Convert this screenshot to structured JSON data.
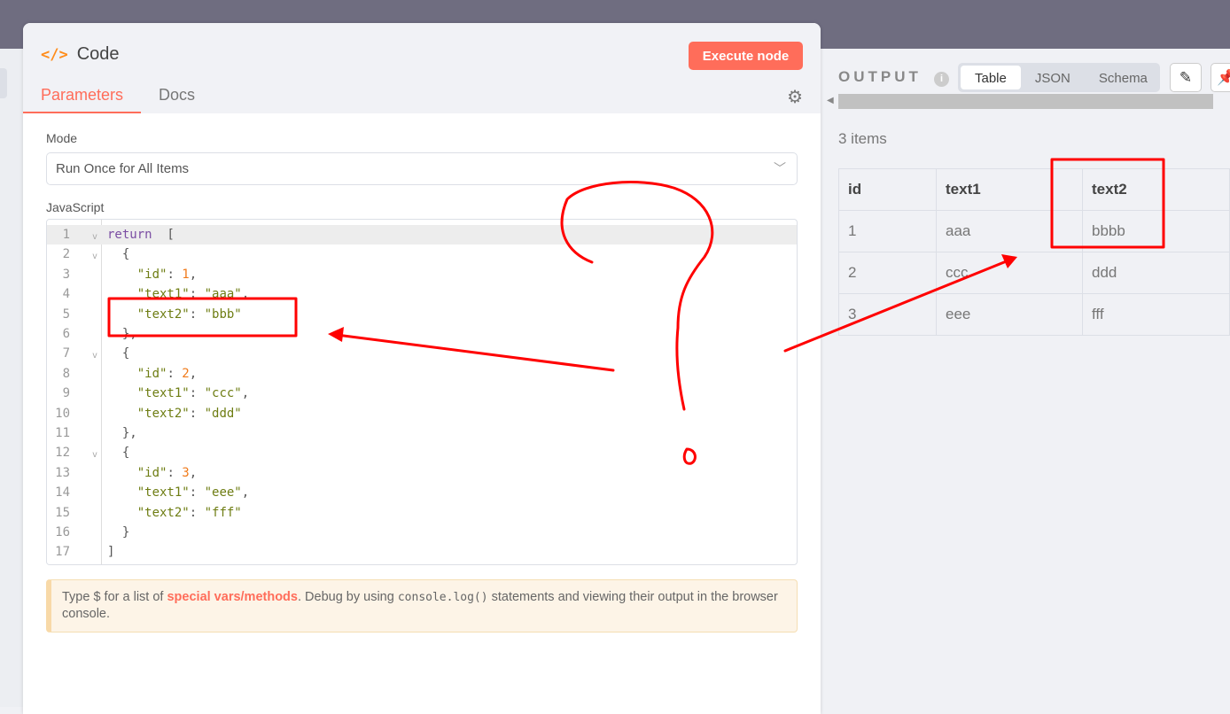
{
  "node": {
    "title": "Code",
    "icon": "code-icon",
    "execute_label": "Execute node",
    "tabs": [
      "Parameters",
      "Docs"
    ],
    "active_tab": "Parameters"
  },
  "params": {
    "mode_label": "Mode",
    "mode_value": "Run Once for All Items",
    "js_label": "JavaScript"
  },
  "code_lines": [
    [
      [
        "kw",
        "return"
      ],
      [
        "",
        "  ["
      ]
    ],
    [
      [
        "",
        "  {"
      ]
    ],
    [
      [
        "",
        "    "
      ],
      [
        "str",
        "\"id\""
      ],
      [
        "",
        ": "
      ],
      [
        "num",
        "1"
      ],
      [
        "",
        ","
      ]
    ],
    [
      [
        "",
        "    "
      ],
      [
        "str",
        "\"text1\""
      ],
      [
        "",
        ": "
      ],
      [
        "str",
        "\"aaa\""
      ],
      [
        "",
        ","
      ]
    ],
    [
      [
        "",
        "    "
      ],
      [
        "str",
        "\"text2\""
      ],
      [
        "",
        ": "
      ],
      [
        "str",
        "\"bbb\""
      ]
    ],
    [
      [
        "",
        "  },"
      ]
    ],
    [
      [
        "",
        "  {"
      ]
    ],
    [
      [
        "",
        "    "
      ],
      [
        "str",
        "\"id\""
      ],
      [
        "",
        ": "
      ],
      [
        "num",
        "2"
      ],
      [
        "",
        ","
      ]
    ],
    [
      [
        "",
        "    "
      ],
      [
        "str",
        "\"text1\""
      ],
      [
        "",
        ": "
      ],
      [
        "str",
        "\"ccc\""
      ],
      [
        "",
        ","
      ]
    ],
    [
      [
        "",
        "    "
      ],
      [
        "str",
        "\"text2\""
      ],
      [
        "",
        ": "
      ],
      [
        "str",
        "\"ddd\""
      ]
    ],
    [
      [
        "",
        "  },"
      ]
    ],
    [
      [
        "",
        "  {"
      ]
    ],
    [
      [
        "",
        "    "
      ],
      [
        "str",
        "\"id\""
      ],
      [
        "",
        ": "
      ],
      [
        "num",
        "3"
      ],
      [
        "",
        ","
      ]
    ],
    [
      [
        "",
        "    "
      ],
      [
        "str",
        "\"text1\""
      ],
      [
        "",
        ": "
      ],
      [
        "str",
        "\"eee\""
      ],
      [
        "",
        ","
      ]
    ],
    [
      [
        "",
        "    "
      ],
      [
        "str",
        "\"text2\""
      ],
      [
        "",
        ": "
      ],
      [
        "str",
        "\"fff\""
      ]
    ],
    [
      [
        "",
        "  }"
      ]
    ],
    [
      [
        "",
        "]"
      ]
    ]
  ],
  "fold_lines": [
    1,
    2,
    7,
    12
  ],
  "hint": {
    "pre": "Type $ for a list of ",
    "link": "special vars/methods",
    "mid": ". Debug by using ",
    "code": "console.log()",
    "post": " statements and viewing their output in the browser console."
  },
  "output": {
    "title": "OUTPUT",
    "views": [
      "Table",
      "JSON",
      "Schema"
    ],
    "active_view": "Table",
    "count": "3 items",
    "columns": [
      "id",
      "text1",
      "text2"
    ],
    "rows": [
      [
        "1",
        "aaa",
        "bbbb"
      ],
      [
        "2",
        "ccc",
        "ddd"
      ],
      [
        "3",
        "eee",
        "fff"
      ]
    ]
  },
  "colors": {
    "accent": "#ff6d5a",
    "annotation": "#ff0000"
  }
}
